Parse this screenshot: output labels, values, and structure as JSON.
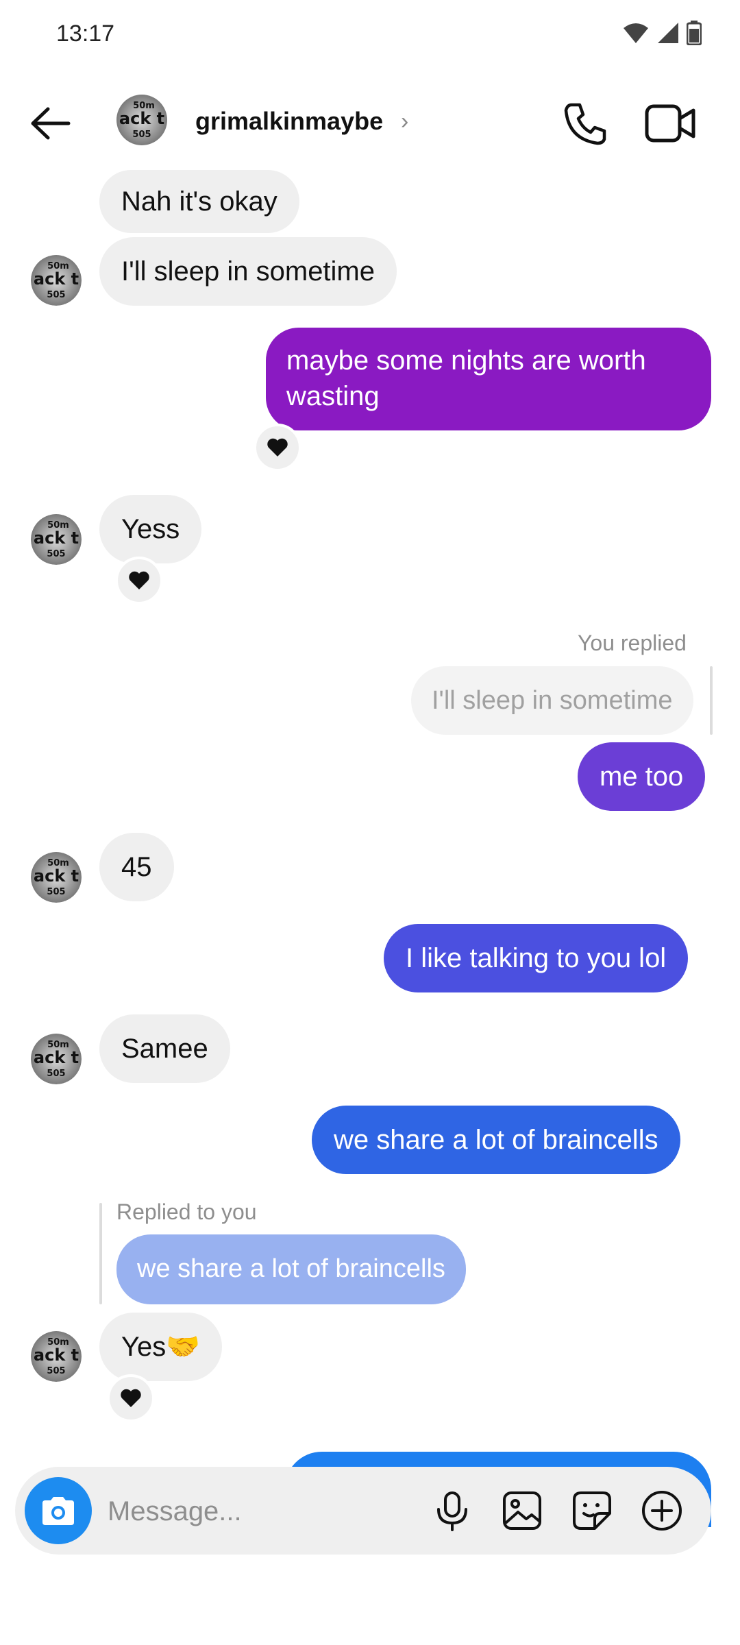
{
  "status_bar": {
    "time": "13:17"
  },
  "header": {
    "username": "grimalkinmaybe",
    "chevron": "›",
    "avatar_text_top": "50m",
    "avatar_text_mid": "ack t",
    "avatar_text_bot": "505"
  },
  "messages": {
    "m1": "Nah it's okay",
    "m2": "I'll sleep in sometime",
    "m3_line1": "maybe some nights are worth",
    "m3_line2": "wasting",
    "m4": "Yess",
    "reply_label_1": "You replied",
    "reply_quote_1": "I'll sleep in sometime",
    "m5": "me too",
    "m6": "45",
    "m7": "I like talking to you lol",
    "m8": "Samee",
    "m9": "we share a lot of braincells",
    "reply_label_2": "Replied to you",
    "reply_quote_2": "we share a lot of braincells",
    "m10": "Yes🤝"
  },
  "composer": {
    "placeholder": "Message..."
  },
  "colors": {
    "outgoing_purple": "#8a1ac2",
    "outgoing_violet": "#6b3ed6",
    "outgoing_indigo": "#4b50e0",
    "outgoing_blue": "#2f65e4",
    "outgoing_bright": "#1d7ff0",
    "quote_blue": "#98b1f0",
    "accent": "#1d8cf0"
  }
}
